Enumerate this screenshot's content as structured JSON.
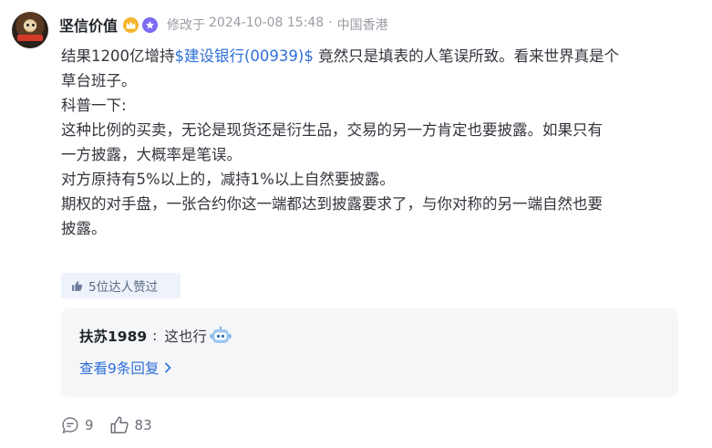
{
  "author": {
    "name": "坚信价值",
    "badges": [
      "crown-icon",
      "star-icon"
    ],
    "edited_label": "修改于",
    "timestamp": "2024-10-08 15:48",
    "separator": "·",
    "location": "中国香港"
  },
  "post": {
    "line1_before": "结果1200亿增持",
    "stock_link": "$建设银行(00939)$",
    "line1_after": " 竟然只是填表的人笔误所致。看来世界真是个",
    "line2": "草台班子。",
    "line3": "科普一下:",
    "line4": "这种比例的买卖，无论是现货还是衍生品，交易的另一方肯定也要披露。如果只有",
    "line5": "一方披露，大概率是笔误。",
    "line6": "对方原持有5%以上的，减持1%以上自然要披露。",
    "line7": "期权的对手盘，一张合约你这一端都达到披露要求了，与你对称的另一端自然也要",
    "line8": "披露。"
  },
  "likers": {
    "label": "5位达人赞过"
  },
  "reply": {
    "user": "扶苏1989",
    "colon": ":",
    "text": "这也行",
    "emoji": "robot-emoji-icon",
    "view_more": "查看9条回复"
  },
  "actions": {
    "comments": "9",
    "likes": "83"
  },
  "colors": {
    "link": "#2e6fd8",
    "pill_bg": "#eef3fb",
    "reply_bg": "#f5f6f8",
    "meta_text": "#9a9da4"
  }
}
